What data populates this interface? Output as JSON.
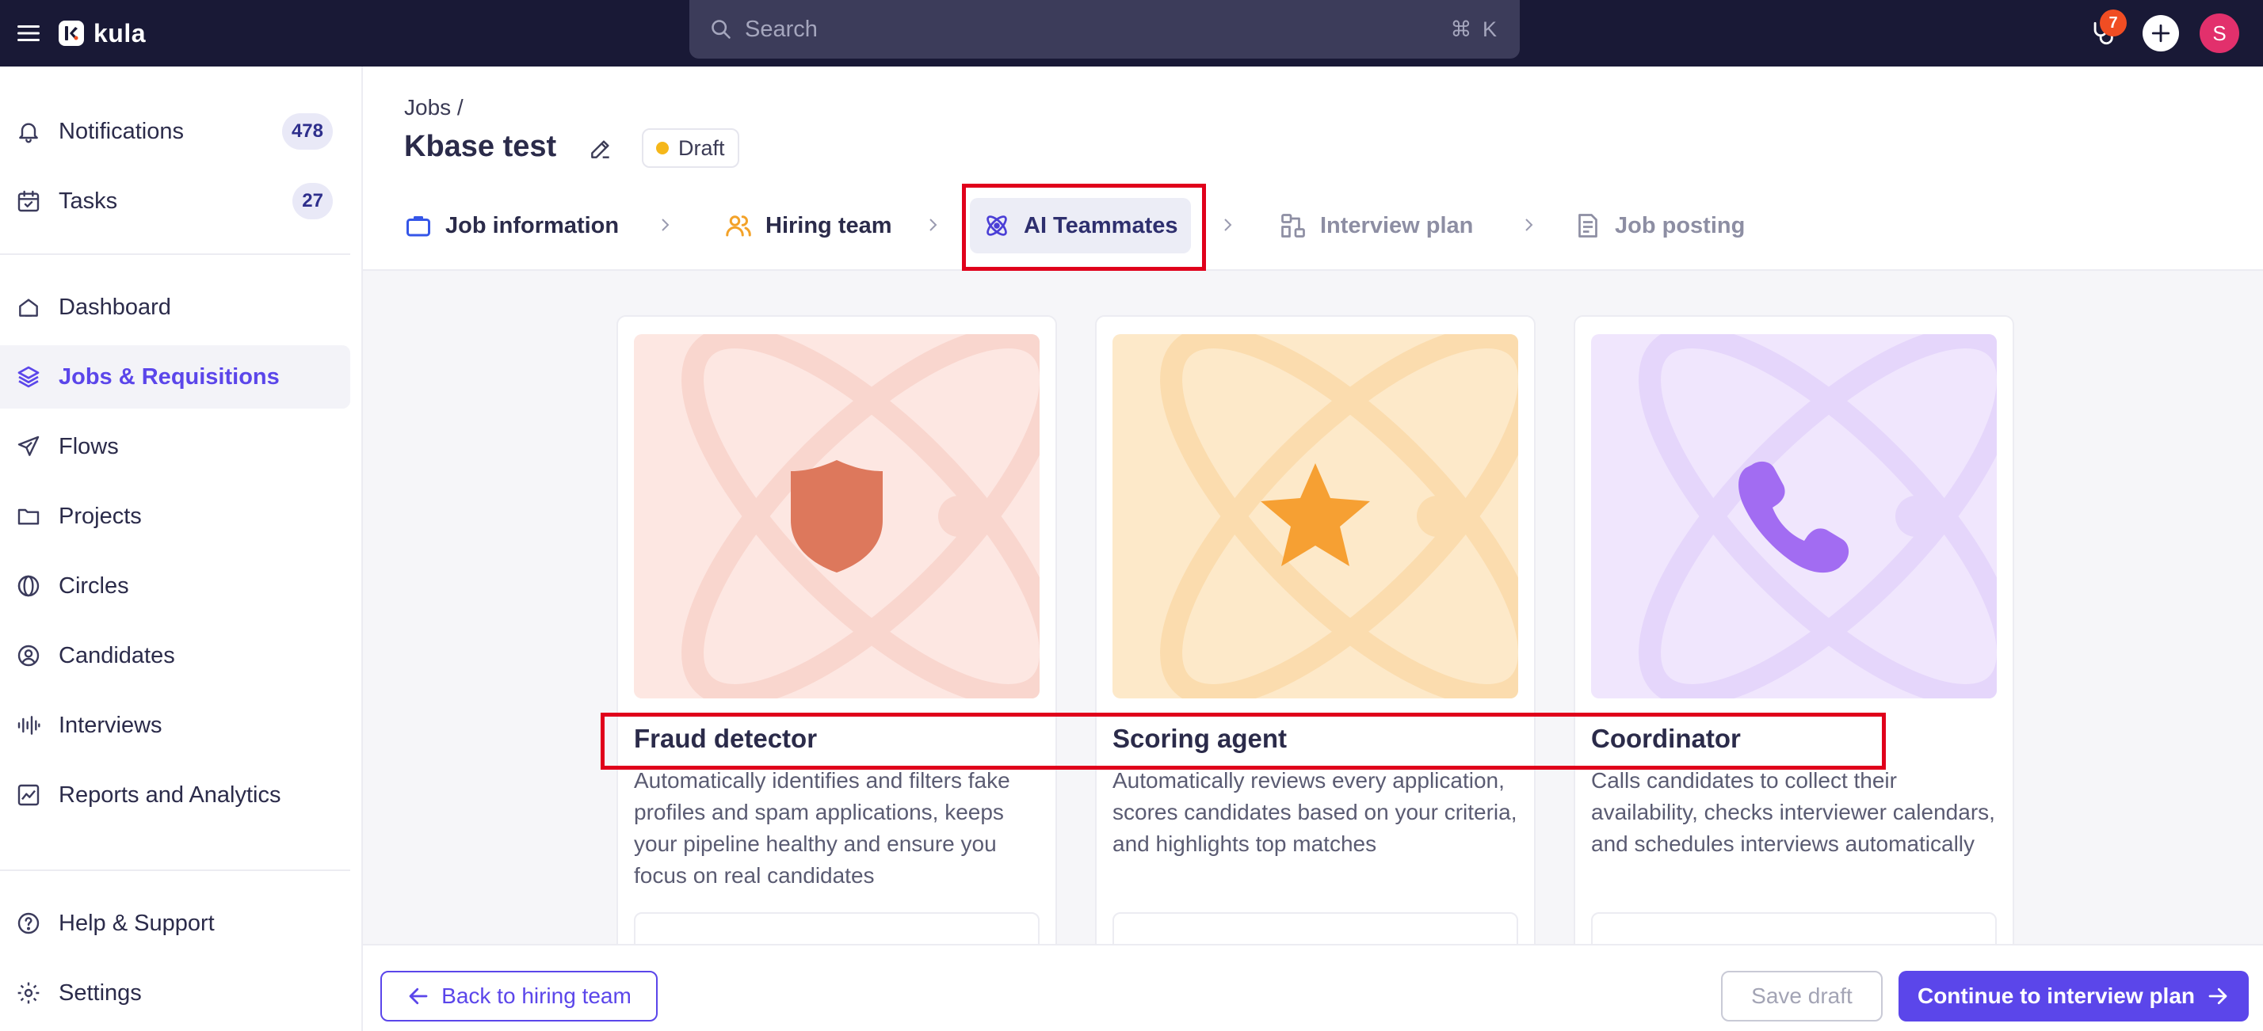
{
  "app": {
    "name": "kula"
  },
  "search": {
    "placeholder": "Search",
    "shortcut": "⌘ K"
  },
  "topbar": {
    "notification_count": "7",
    "user_initial": "S"
  },
  "sidebar": {
    "top_items": [
      {
        "label": "Notifications",
        "icon": "bell-icon",
        "count": "478"
      },
      {
        "label": "Tasks",
        "icon": "calendar-check-icon",
        "count": "27"
      }
    ],
    "items": [
      {
        "label": "Dashboard",
        "icon": "home-icon"
      },
      {
        "label": "Jobs & Requisitions",
        "icon": "layers-icon",
        "active": true
      },
      {
        "label": "Flows",
        "icon": "send-icon"
      },
      {
        "label": "Projects",
        "icon": "folder-icon"
      },
      {
        "label": "Circles",
        "icon": "circles-icon"
      },
      {
        "label": "Candidates",
        "icon": "user-circle-icon"
      },
      {
        "label": "Interviews",
        "icon": "audio-wave-icon"
      },
      {
        "label": "Reports and Analytics",
        "icon": "chart-icon"
      }
    ],
    "bottom_items": [
      {
        "label": "Help & Support",
        "icon": "help-icon"
      },
      {
        "label": "Settings",
        "icon": "gear-icon"
      }
    ]
  },
  "header": {
    "breadcrumb": "Jobs /",
    "title": "Kbase test",
    "status": "Draft"
  },
  "steps": [
    {
      "label": "Job information",
      "icon": "briefcase-icon",
      "state": "done"
    },
    {
      "label": "Hiring team",
      "icon": "users-icon",
      "state": "done"
    },
    {
      "label": "AI Teammates",
      "icon": "atom-icon",
      "state": "current"
    },
    {
      "label": "Interview plan",
      "icon": "plan-icon",
      "state": "pending"
    },
    {
      "label": "Job posting",
      "icon": "document-icon",
      "state": "pending"
    }
  ],
  "cards": [
    {
      "title": "Fraud detector",
      "description": "Automatically identifies and filters fake profiles and spam applications, keeps your pipeline healthy and ensure you focus on real candidates",
      "icon": "shield-icon",
      "colors": {
        "bg": "#fde7e2",
        "art": "#f9d6ce",
        "icon": "#dd785c"
      }
    },
    {
      "title": "Scoring agent",
      "description": "Automatically reviews every application, scores candidates based on your criteria, and highlights top matches",
      "icon": "star-icon",
      "colors": {
        "bg": "#fde9c9",
        "art": "#fbdcae",
        "icon": "#f6a033"
      }
    },
    {
      "title": "Coordinator",
      "description": "Calls candidates to collect their availability, checks interviewer calendars, and schedules interviews automatically",
      "icon": "phone-icon",
      "colors": {
        "bg": "#f0e6fd",
        "art": "#e5d6fb",
        "icon": "#a26cf2"
      }
    }
  ],
  "footer": {
    "back_label": "Back to hiring team",
    "draft_label": "Save draft",
    "continue_label": "Continue to interview plan"
  },
  "colors": {
    "accent": "#5b46ea",
    "topbar": "#191936",
    "highlight": "#e0001b"
  }
}
